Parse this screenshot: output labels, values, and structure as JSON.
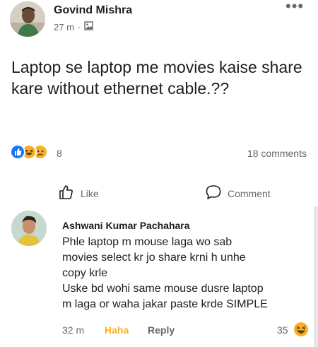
{
  "post": {
    "author": "Govind Mishra",
    "time": "27 m",
    "separator": "·",
    "audience_icon": "album-icon",
    "more_icon": "more-dots-icon",
    "more_label": "•••",
    "text": "Laptop se laptop me movies kaise share kare without ethernet cable.??"
  },
  "stats": {
    "reaction_icons": [
      "like-reaction-icon",
      "haha-reaction-icon",
      "sad-reaction-icon"
    ],
    "reaction_count": "8",
    "comments": "18 comments"
  },
  "actions": {
    "like_label": "Like",
    "comment_label": "Comment"
  },
  "comment": {
    "author": "Ashwani Kumar Pachahara",
    "lines": [
      "Phle laptop m mouse laga wo sab",
      "movies select kr jo share krni h unhe",
      "copy krle",
      "Uske bd wohi same mouse dusre laptop",
      "m laga or waha jakar paste krde SIMPLE"
    ],
    "time": "32 m",
    "reaction_label": "Haha",
    "reply_label": "Reply",
    "reaction_count": "35"
  },
  "colors": {
    "text": "#1c1e21",
    "secondary": "#65676b",
    "like_blue": "#1877f2",
    "haha_yellow": "#f7b125"
  }
}
